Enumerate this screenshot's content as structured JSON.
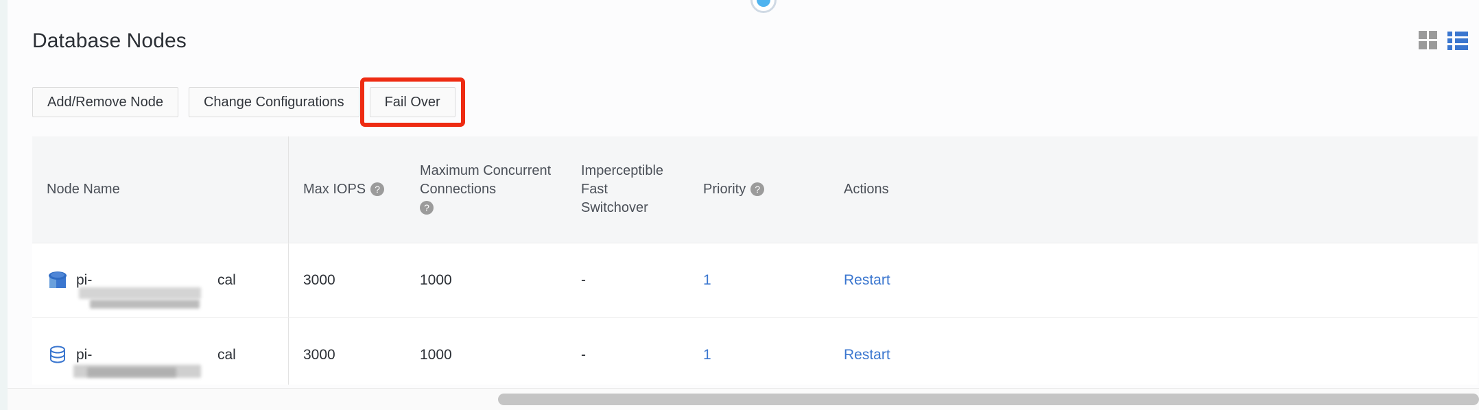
{
  "panel": {
    "title": "Database Nodes"
  },
  "view_toggle": {
    "grid_icon": "grid-view-icon",
    "list_icon": "list-view-icon",
    "active": "list"
  },
  "step_indicator": {
    "icon": "step-dot-icon",
    "color": "#4fb3ef"
  },
  "actions": {
    "add_remove_node": "Add/Remove Node",
    "change_configurations": "Change Configurations",
    "fail_over": "Fail Over",
    "highlighted": "Fail Over",
    "highlight_color": "#ee2b12"
  },
  "table": {
    "columns": [
      {
        "label": "Node Name",
        "help": false
      },
      {
        "label": "Max IOPS",
        "help": true
      },
      {
        "label": "Maximum Concurrent Connections",
        "help": true
      },
      {
        "label": "Imperceptible Fast Switchover",
        "help": false
      },
      {
        "label": "Priority",
        "help": true
      },
      {
        "label": "Actions",
        "help": false
      }
    ],
    "column_lines": {
      "conn_line1": "Maximum Concurrent",
      "conn_line2": "Connections",
      "fast_line1": "Imperceptible",
      "fast_line2": "Fast",
      "fast_line3": "Switchover"
    },
    "help_glyph": "?",
    "rows": [
      {
        "icon": "database-primary-icon",
        "name_prefix": "pi-",
        "name_overflow": "cal",
        "name_redacted": true,
        "max_iops": "3000",
        "max_connections": "1000",
        "fast_switchover": "-",
        "priority": "1",
        "action": "Restart"
      },
      {
        "icon": "database-replica-icon",
        "name_prefix": "pi-",
        "name_overflow": "cal",
        "name_redacted": true,
        "max_iops": "3000",
        "max_connections": "1000",
        "fast_switchover": "-",
        "priority": "1",
        "action": "Restart"
      }
    ]
  },
  "scrollbar": {
    "orientation": "horizontal",
    "name": "horizontal-scrollbar"
  },
  "colors": {
    "link": "#3a76cf",
    "accent": "#4fb3ef",
    "annotation": "#ee2b12",
    "header_bg": "#f5f6f7"
  }
}
